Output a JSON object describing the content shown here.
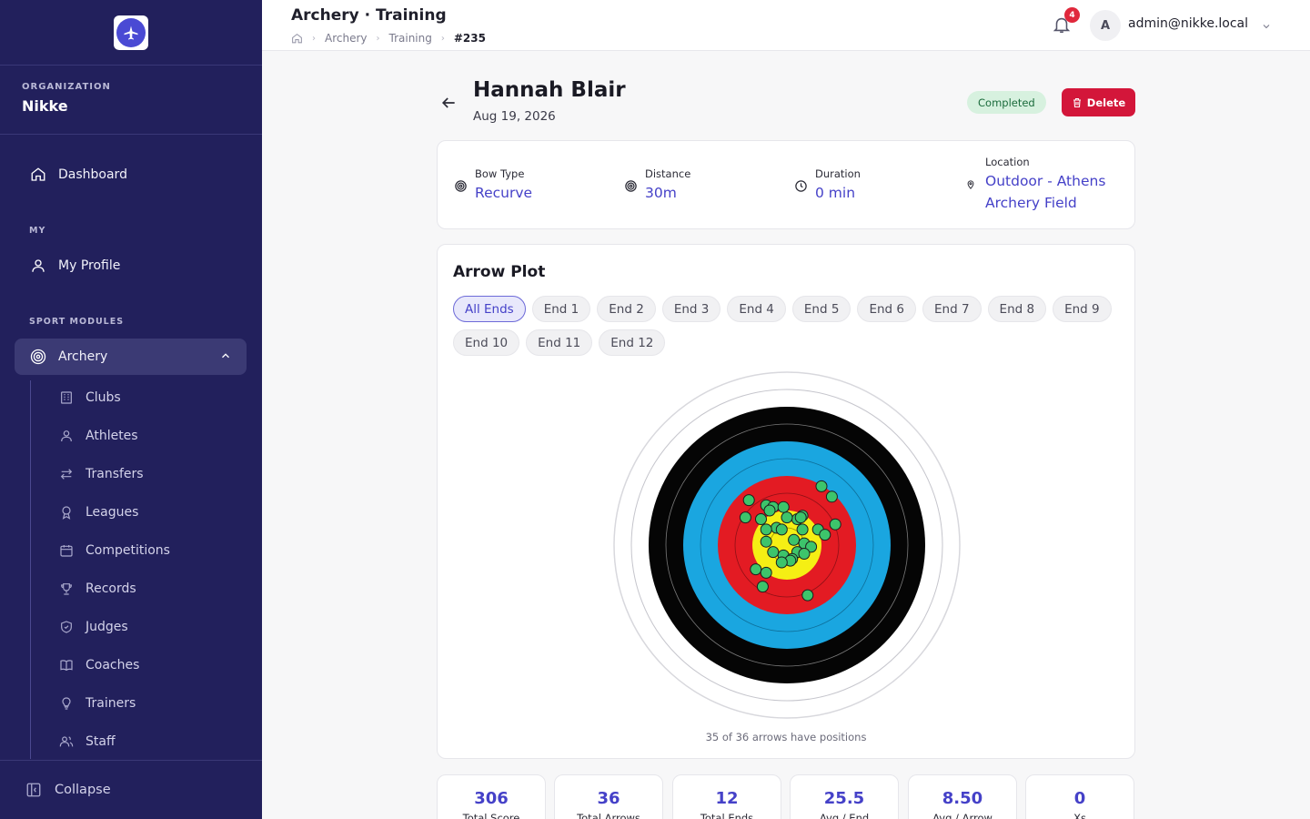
{
  "sidebar": {
    "org_label": "ORGANIZATION",
    "org_name": "Nikke",
    "dashboard": "Dashboard",
    "section_my": "MY",
    "my_profile": "My Profile",
    "section_modules": "SPORT MODULES",
    "archery": "Archery",
    "sub_items": [
      "Clubs",
      "Athletes",
      "Transfers",
      "Leagues",
      "Competitions",
      "Records",
      "Judges",
      "Coaches",
      "Trainers",
      "Staff"
    ],
    "collapse": "Collapse"
  },
  "header": {
    "title": "Archery · Training",
    "breadcrumb": [
      "Archery",
      "Training",
      "#235"
    ],
    "notifications": "4",
    "avatar_initial": "A",
    "user_email": "admin@nikke.local"
  },
  "session": {
    "athlete_name": "Hannah Blair",
    "date": "Aug 19, 2026",
    "status": "Completed",
    "delete_label": "Delete",
    "bow_type_label": "Bow Type",
    "bow_type": "Recurve",
    "distance_label": "Distance",
    "distance": "30m",
    "duration_label": "Duration",
    "duration": "0 min",
    "location_label": "Location",
    "location": "Outdoor - Athens Archery Field"
  },
  "arrow_plot": {
    "title": "Arrow Plot",
    "filters": [
      "All Ends",
      "End 1",
      "End 2",
      "End 3",
      "End 4",
      "End 5",
      "End 6",
      "End 7",
      "End 8",
      "End 9",
      "End 10",
      "End 11",
      "End 12"
    ],
    "active_filter": "All Ends",
    "caption": "35 of 36 arrows have positions",
    "arrows": [
      [
        0.2,
        0.34
      ],
      [
        0.26,
        0.28
      ],
      [
        -0.22,
        0.26
      ],
      [
        -0.12,
        0.23
      ],
      [
        -0.08,
        0.22
      ],
      [
        0.09,
        0.17
      ],
      [
        -0.02,
        0.22
      ],
      [
        -0.24,
        0.16
      ],
      [
        -0.15,
        0.15
      ],
      [
        0.06,
        0.15
      ],
      [
        0.0,
        0.16
      ],
      [
        0.08,
        0.16
      ],
      [
        0.28,
        0.12
      ],
      [
        -0.06,
        0.1
      ],
      [
        -0.12,
        0.09
      ],
      [
        -0.03,
        0.09
      ],
      [
        0.09,
        0.09
      ],
      [
        0.18,
        0.09
      ],
      [
        0.22,
        0.06
      ],
      [
        0.04,
        0.03
      ],
      [
        -0.12,
        0.02
      ],
      [
        0.1,
        0.01
      ],
      [
        0.14,
        -0.01
      ],
      [
        0.06,
        -0.04
      ],
      [
        -0.08,
        -0.04
      ],
      [
        0.1,
        -0.05
      ],
      [
        -0.02,
        -0.06
      ],
      [
        0.03,
        -0.08
      ],
      [
        0.02,
        -0.09
      ],
      [
        -0.03,
        -0.1
      ],
      [
        -0.18,
        -0.14
      ],
      [
        -0.12,
        -0.16
      ],
      [
        -0.14,
        -0.24
      ],
      [
        0.12,
        -0.29
      ],
      [
        -0.1,
        0.2
      ]
    ]
  },
  "stats": [
    {
      "value": "306",
      "label": "Total Score"
    },
    {
      "value": "36",
      "label": "Total Arrows"
    },
    {
      "value": "12",
      "label": "Total Ends"
    },
    {
      "value": "25.5",
      "label": "Avg / End"
    },
    {
      "value": "8.50",
      "label": "Avg / Arrow"
    },
    {
      "value": "0",
      "label": "Xs"
    }
  ],
  "colors": {
    "sidebar_bg": "#22205c",
    "accent": "#4541c8",
    "target_gold": "#f5ef14",
    "target_red": "#e31b23",
    "target_blue": "#1aa6e0",
    "target_black": "#050505",
    "arrow_dot": "#3dc46b"
  }
}
